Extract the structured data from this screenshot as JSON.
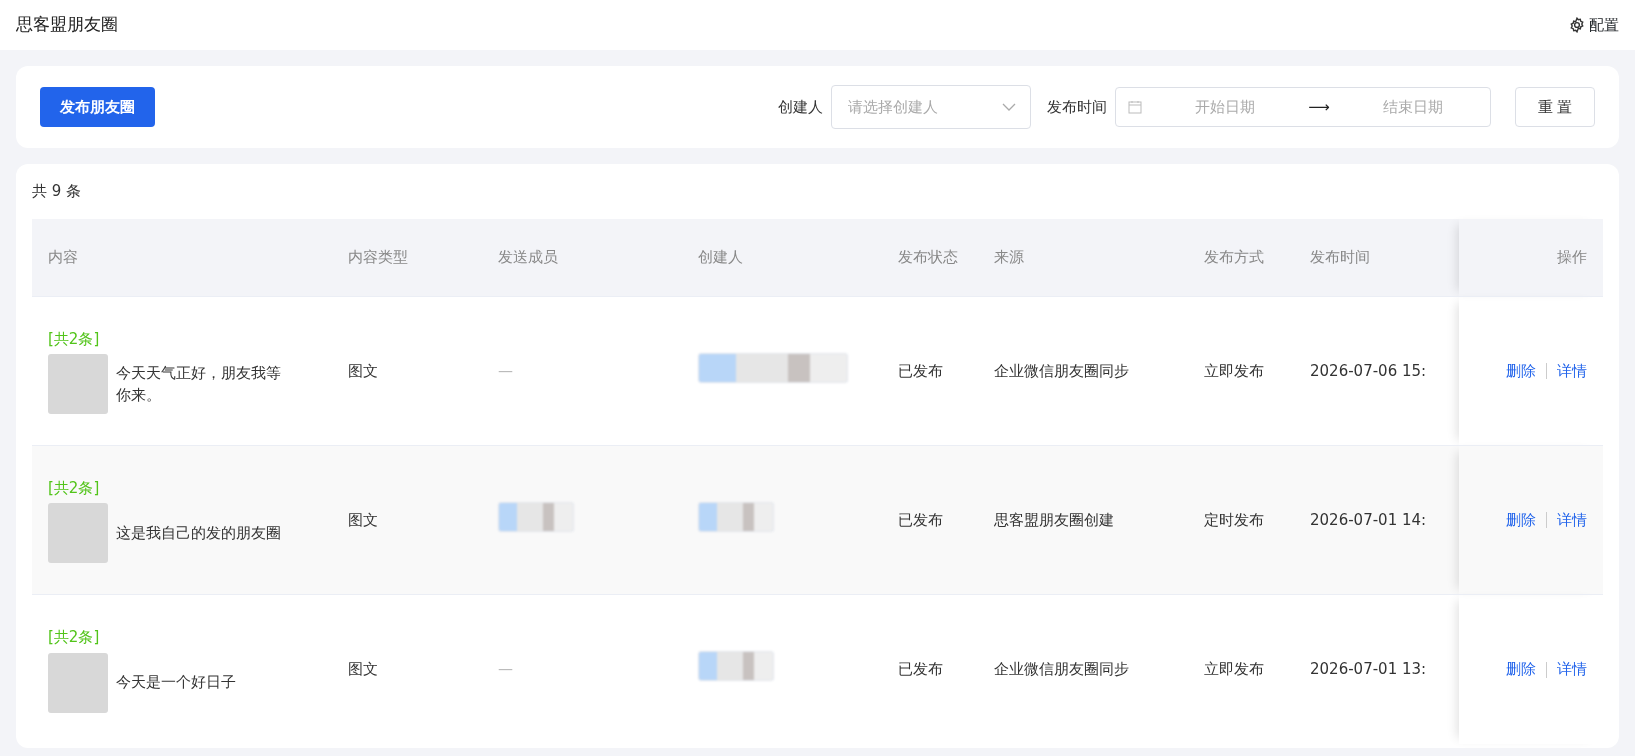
{
  "header": {
    "title": "思客盟朋友圈",
    "settings_label": "配置"
  },
  "filters": {
    "publish_button": "发布朋友圈",
    "creator_label": "创建人",
    "creator_placeholder": "请选择创建人",
    "time_label": "发布时间",
    "start_placeholder": "开始日期",
    "arrow": "⟶",
    "end_placeholder": "结束日期",
    "reset_button": "重 置"
  },
  "table": {
    "total": "共 9 条",
    "columns": [
      "内容",
      "内容类型",
      "发送成员",
      "创建人",
      "发布状态",
      "来源",
      "发布方式",
      "发布时间",
      "操作"
    ],
    "rows": [
      {
        "count": "[共2条]",
        "text": "今天天气正好，朋友我等你来。",
        "type": "图文",
        "members": {
          "kind": "dash",
          "text": "—"
        },
        "creator": {
          "kind": "redacted"
        },
        "status": "已发布",
        "source": "企业微信朋友圈同步",
        "method": "立即发布",
        "time": "2026-07-06 15:",
        "actions": [
          "删除",
          "详情"
        ]
      },
      {
        "count": "[共2条]",
        "text": "这是我自己的发的朋友圈",
        "type": "图文",
        "members": {
          "kind": "redacted"
        },
        "creator": {
          "kind": "redacted"
        },
        "status": "已发布",
        "source": "思客盟朋友圈创建",
        "method": "定时发布",
        "time": "2026-07-01 14:",
        "actions": [
          "删除",
          "详情"
        ]
      },
      {
        "count": "[共2条]",
        "text": "今天是一个好日子",
        "type": "图文",
        "members": {
          "kind": "dash",
          "text": "—"
        },
        "creator": {
          "kind": "redacted"
        },
        "status": "已发布",
        "source": "企业微信朋友圈同步",
        "method": "立即发布",
        "time": "2026-07-01 13:",
        "actions": [
          "删除",
          "详情"
        ]
      }
    ]
  }
}
